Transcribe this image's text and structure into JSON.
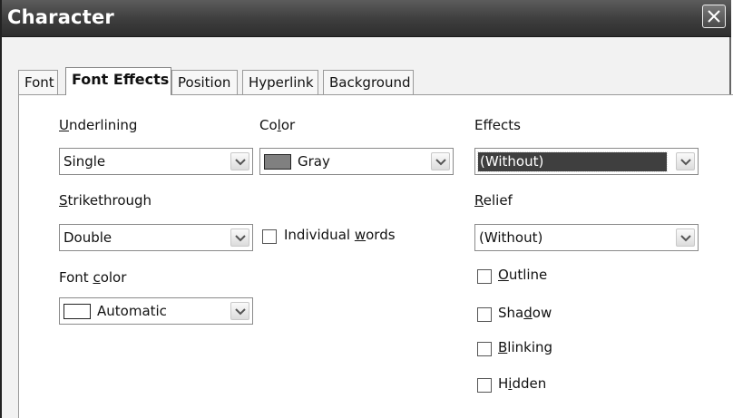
{
  "dialog": {
    "title": "Character",
    "close_icon": "close-icon"
  },
  "tabs": [
    {
      "label": "Font"
    },
    {
      "label": "Font Effects"
    },
    {
      "label": "Position"
    },
    {
      "label": "Hyperlink"
    },
    {
      "label": "Background"
    }
  ],
  "active_tab": "Font Effects",
  "underlining": {
    "label_pre": "",
    "label_mn": "U",
    "label_post": "nderlining",
    "value": "Single"
  },
  "strikethrough": {
    "label_pre": "",
    "label_mn": "S",
    "label_post": "trikethrough",
    "value": "Double"
  },
  "font_color": {
    "label_pre": "Font ",
    "label_mn": "c",
    "label_post": "olor",
    "value": "Automatic",
    "swatch": "#ffffff"
  },
  "color": {
    "label_pre": "Co",
    "label_mn": "l",
    "label_post": "or",
    "value": "Gray",
    "swatch": "#808080"
  },
  "individual_words": {
    "pre": "Individual ",
    "mn": "w",
    "post": "ords",
    "checked": false
  },
  "effects": {
    "label": "Effects",
    "value": "(Without)"
  },
  "relief": {
    "label_pre": "",
    "label_mn": "R",
    "label_post": "elief",
    "value": "(Without)"
  },
  "outline": {
    "pre": "",
    "mn": "O",
    "post": "utline",
    "checked": false
  },
  "shadow": {
    "pre": "Sha",
    "mn": "d",
    "post": "ow",
    "checked": false
  },
  "blinking": {
    "pre": "",
    "mn": "B",
    "post": "linking",
    "checked": false
  },
  "hidden": {
    "pre": "H",
    "mn": "i",
    "post": "dden",
    "checked": false
  }
}
